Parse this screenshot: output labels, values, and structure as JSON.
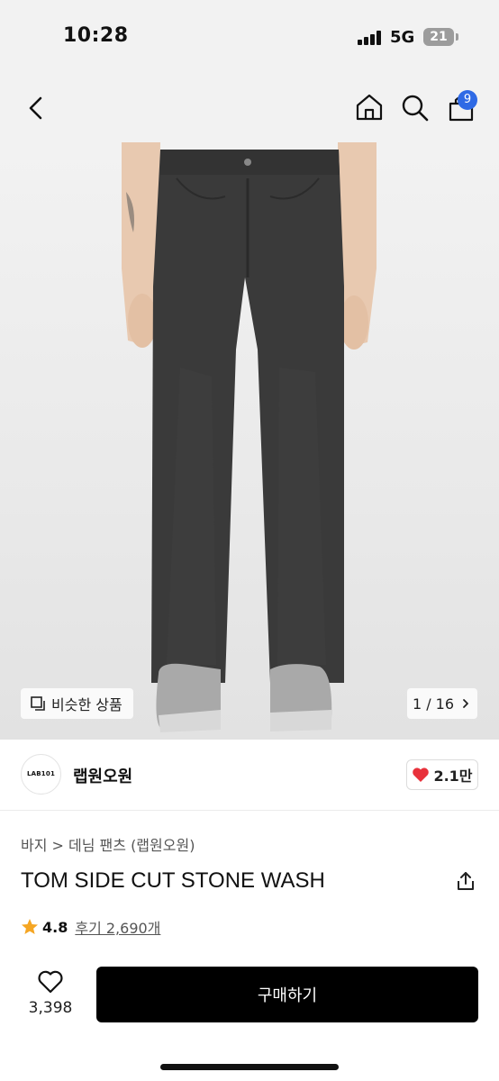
{
  "status_bar": {
    "time": "10:28",
    "network": "5G",
    "battery": "21"
  },
  "header": {
    "cart_count": "9"
  },
  "gallery": {
    "similar_label": "비슷한 상품",
    "pager": "1 / 16"
  },
  "brand": {
    "logo_text": "LAB101",
    "name": "랩원오원",
    "likes": "2.1만"
  },
  "product": {
    "breadcrumb": "바지 > 데님 팬츠 (랩원오원)",
    "title": "TOM SIDE CUT STONE WASH",
    "rating": "4.8",
    "reviews": "후기 2,690개"
  },
  "bottom_bar": {
    "wish_count": "3,398",
    "buy_label": "구매하기"
  },
  "colors": {
    "accent": "#2f6ae5",
    "heart": "#e8313b",
    "star": "#f5a623",
    "buy_button": "#000000",
    "jeans": "#3a3a3a"
  },
  "icons": [
    "back-icon",
    "home-icon",
    "search-icon",
    "cart-icon",
    "similar-icon",
    "chevron-right-icon",
    "heart-icon",
    "share-icon",
    "star-icon",
    "heart-outline-icon"
  ]
}
